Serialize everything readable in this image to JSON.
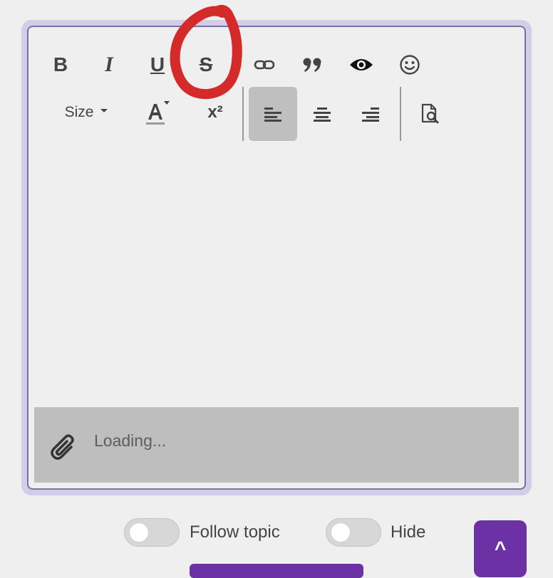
{
  "toolbar": {
    "size_label": "Size",
    "superscript_label": "x²",
    "buttons": [
      {
        "name": "bold",
        "glyph": "B"
      },
      {
        "name": "italic",
        "glyph": "I"
      },
      {
        "name": "underline",
        "glyph": "U"
      },
      {
        "name": "strikethrough",
        "glyph": "S"
      }
    ],
    "active_alignment": "align-left"
  },
  "attachments": {
    "status": "Loading..."
  },
  "options": {
    "follow_label": "Follow topic",
    "hide_label": "Hide"
  },
  "scroll_top": {
    "label": "^"
  },
  "colors": {
    "accent": "#6c31a5",
    "border": "#7c6fa8",
    "annotation": "#d42a2a"
  }
}
